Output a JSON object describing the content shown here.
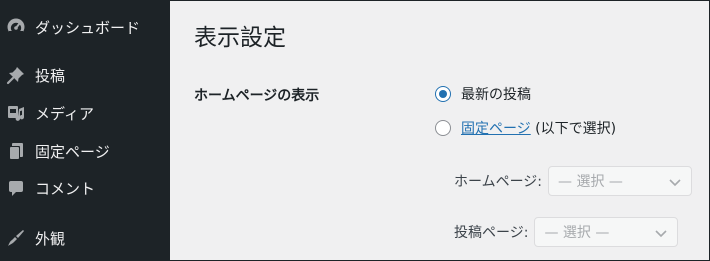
{
  "sidebar": {
    "items": [
      {
        "label": "ダッシュボード",
        "icon": "dashboard-icon"
      },
      {
        "label": "投稿",
        "icon": "pin-icon"
      },
      {
        "label": "メディア",
        "icon": "media-icon"
      },
      {
        "label": "固定ページ",
        "icon": "pages-icon"
      },
      {
        "label": "コメント",
        "icon": "comment-icon"
      },
      {
        "label": "外観",
        "icon": "appearance-icon"
      }
    ]
  },
  "main": {
    "title": "表示設定",
    "homepage_display_label": "ホームページの表示",
    "options": {
      "latest_posts": "最新の投稿",
      "static_page_link": "固定ページ",
      "static_page_suffix": " (以下で選択)"
    },
    "selected_option": "latest_posts",
    "homepage_select": {
      "label": "ホームページ:",
      "value": "— 選択 —"
    },
    "posts_page_select": {
      "label": "投稿ページ:",
      "value": "— 選択 —"
    }
  },
  "colors": {
    "sidebar_bg": "#1d2327",
    "content_bg": "#f0f0f1",
    "accent": "#2271b1",
    "icon_color": "#a7aaad"
  }
}
